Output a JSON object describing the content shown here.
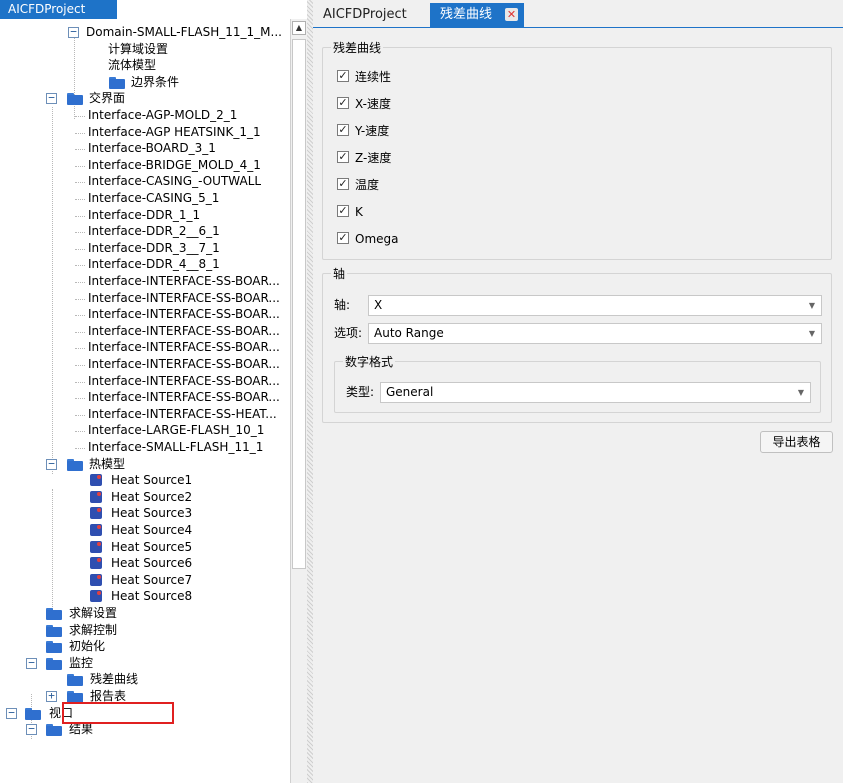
{
  "left_panel": {
    "title": "AICFDProject"
  },
  "tree": {
    "domain_node": "Domain-SMALL-FLASH_11_1_M...",
    "domain_children": [
      "计算域设置",
      "流体模型",
      "边界条件"
    ],
    "interfaces_label": "交界面",
    "interfaces": [
      "Interface-AGP-MOLD_2_1",
      "Interface-AGP HEATSINK_1_1",
      "Interface-BOARD_3_1",
      "Interface-BRIDGE_MOLD_4_1",
      "Interface-CASING_-OUTWALL",
      "Interface-CASING_5_1",
      "Interface-DDR_1_1",
      "Interface-DDR_2__6_1",
      "Interface-DDR_3__7_1",
      "Interface-DDR_4__8_1",
      "Interface-INTERFACE-SS-BOAR...",
      "Interface-INTERFACE-SS-BOAR...",
      "Interface-INTERFACE-SS-BOAR...",
      "Interface-INTERFACE-SS-BOAR...",
      "Interface-INTERFACE-SS-BOAR...",
      "Interface-INTERFACE-SS-BOAR...",
      "Interface-INTERFACE-SS-BOAR...",
      "Interface-INTERFACE-SS-BOAR...",
      "Interface-INTERFACE-SS-HEAT...",
      "Interface-LARGE-FLASH_10_1",
      "Interface-SMALL-FLASH_11_1"
    ],
    "thermal_label": "热模型",
    "heat_sources": [
      "Heat Source1",
      "Heat Source2",
      "Heat Source3",
      "Heat Source4",
      "Heat Source5",
      "Heat Source6",
      "Heat Source7",
      "Heat Source8"
    ],
    "solver_settings": "求解设置",
    "solver_control": "求解控制",
    "initialization": "初始化",
    "monitor": "监控",
    "residual_curve": "残差曲线",
    "report_table": "报告表",
    "view": "视口",
    "results": "结果"
  },
  "tabs": [
    {
      "label": "AICFDProject",
      "active": false
    },
    {
      "label": "残差曲线",
      "active": true
    }
  ],
  "residual_group": {
    "title": "残差曲线",
    "items": [
      {
        "label": "连续性",
        "checked": true
      },
      {
        "label": "X-速度",
        "checked": true
      },
      {
        "label": "Y-速度",
        "checked": true
      },
      {
        "label": "Z-速度",
        "checked": true
      },
      {
        "label": "温度",
        "checked": true
      },
      {
        "label": "K",
        "checked": true
      },
      {
        "label": "Omega",
        "checked": true
      }
    ]
  },
  "axis_group": {
    "title": "轴",
    "axis_label": "轴:",
    "axis_value": "X",
    "option_label": "选项:",
    "option_value": "Auto Range",
    "number_format": {
      "title": "数字格式",
      "type_label": "类型:",
      "type_value": "General"
    }
  },
  "export_button": "导出表格",
  "colors": {
    "accent": "#1e73c8",
    "highlight": "#e02020"
  }
}
